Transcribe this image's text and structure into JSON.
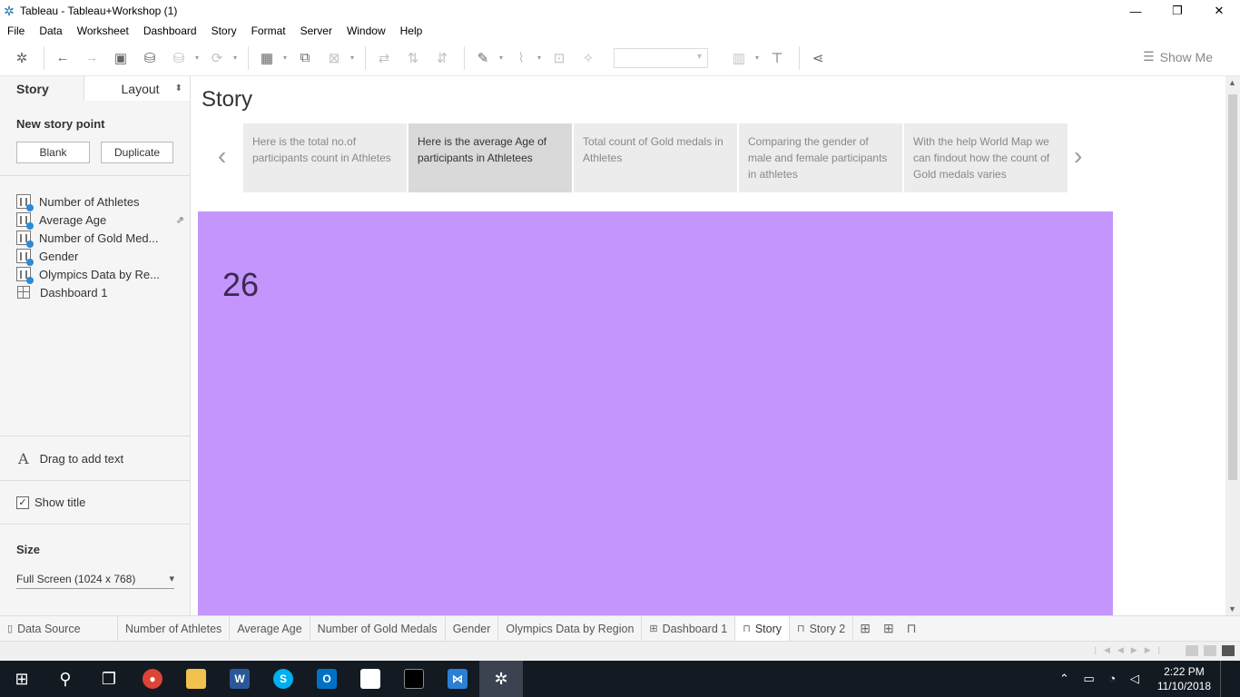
{
  "window": {
    "title": "Tableau - Tableau+Workshop (1)",
    "minimize": "—",
    "restore": "❐",
    "close": "✕"
  },
  "menu": [
    "File",
    "Data",
    "Worksheet",
    "Dashboard",
    "Story",
    "Format",
    "Server",
    "Window",
    "Help"
  ],
  "toolbar": {
    "show_me": "Show Me"
  },
  "left_panel": {
    "tab_story": "Story",
    "tab_layout": "Layout",
    "new_story_point": "New story point",
    "blank_button": "Blank",
    "duplicate_button": "Duplicate",
    "sheets": [
      {
        "label": "Number of Athletes",
        "kind": "worksheet"
      },
      {
        "label": "Average Age",
        "kind": "worksheet"
      },
      {
        "label": "Number of Gold Med...",
        "kind": "worksheet"
      },
      {
        "label": "Gender",
        "kind": "worksheet"
      },
      {
        "label": "Olympics Data by Re...",
        "kind": "worksheet"
      },
      {
        "label": "Dashboard 1",
        "kind": "dashboard"
      }
    ],
    "drag_text": "Drag to add text",
    "show_title": "Show title",
    "size_heading": "Size",
    "size_value": "Full Screen (1024 x 768)"
  },
  "story": {
    "title": "Story",
    "points": [
      "Here is the total no.of participants count in Athletes",
      "Here is the average Age of participants in Athletees",
      "Total count of Gold medals in Athletes",
      "Comparing the gender of male and female participants in athletes",
      "With the help World Map we can findout how the count of Gold medals varies"
    ],
    "selected_index": 1,
    "value": "26",
    "viz_color": "#c495fd"
  },
  "tabs": [
    {
      "label": "Data Source",
      "icon": "▯"
    },
    {
      "label": "Number of Athletes",
      "icon": ""
    },
    {
      "label": "Average Age",
      "icon": ""
    },
    {
      "label": "Number of Gold Medals",
      "icon": ""
    },
    {
      "label": "Gender",
      "icon": ""
    },
    {
      "label": "Olympics Data by Region",
      "icon": ""
    },
    {
      "label": "Dashboard 1",
      "icon": "⊞"
    },
    {
      "label": "Story",
      "icon": "⊓"
    },
    {
      "label": "Story 2",
      "icon": "⊓"
    }
  ],
  "taskbar": {
    "time": "2:22 PM",
    "date": "11/10/2018"
  }
}
